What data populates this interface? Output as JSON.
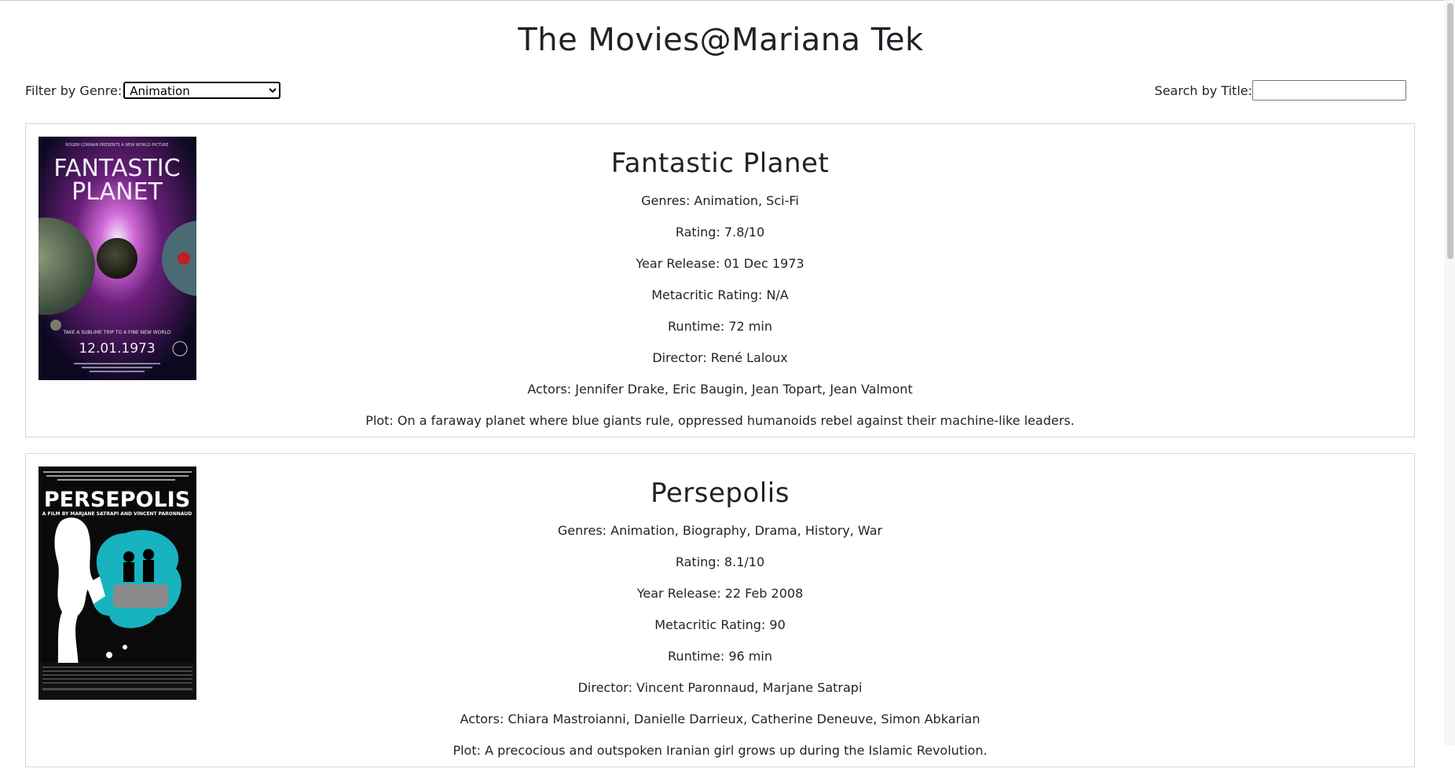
{
  "page": {
    "title": "The Movies@Mariana Tek"
  },
  "filter": {
    "label": "Filter by Genre:",
    "selected": "Animation"
  },
  "search": {
    "label": "Search by Title:",
    "value": "",
    "placeholder": ""
  },
  "movies": [
    {
      "title": "Fantastic Planet",
      "genres": "Genres: Animation, Sci-Fi",
      "rating": "Rating: 7.8/10",
      "year": "Year Release: 01 Dec 1973",
      "metacritic": "Metacritic Rating: N/A",
      "runtime": "Runtime: 72 min",
      "director": "Director: René Laloux",
      "actors": "Actors: Jennifer Drake, Eric Baugin, Jean Topart, Jean Valmont",
      "plot": "Plot: On a faraway planet where blue giants rule, oppressed humanoids rebel against their machine-like leaders.",
      "poster": {
        "top_text": "ROGER CORMAN PRESENTS A NEW WORLD PICTURE",
        "title_line1": "FANTASTIC",
        "title_line2": "PLANET",
        "tagline": "TAKE A SUBLIME TRIP TO A FINE NEW WORLD",
        "date": "12.01.1973"
      }
    },
    {
      "title": "Persepolis",
      "genres": "Genres: Animation, Biography, Drama, History, War",
      "rating": "Rating: 8.1/10",
      "year": "Year Release: 22 Feb 2008",
      "metacritic": "Metacritic Rating: 90",
      "runtime": "Runtime: 96 min",
      "director": "Director: Vincent Paronnaud, Marjane Satrapi",
      "actors": "Actors: Chiara Mastroianni, Danielle Darrieux, Catherine Deneuve, Simon Abkarian",
      "plot": "Plot: A precocious and outspoken Iranian girl grows up during the Islamic Revolution.",
      "poster": {
        "title": "PERSEPOLIS",
        "byline": "A FILM BY MARJANE SATRAPI AND VINCENT PARONNAUD"
      }
    }
  ]
}
